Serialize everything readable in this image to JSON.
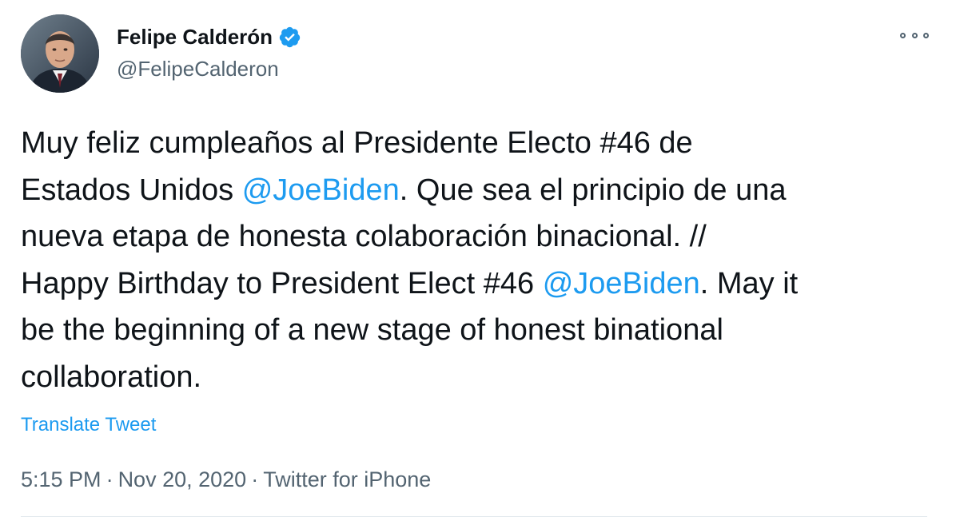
{
  "author": {
    "display_name": "Felipe Calderón",
    "handle": "@FelipeCalderon",
    "verified": true,
    "avatar_icon": "profile-photo"
  },
  "more_icon": "more-options-icon",
  "tweet": {
    "lines": [
      [
        "Muy feliz cumpleaños al Presidente Electo #46 de"
      ],
      [
        "Estados Unidos ",
        "@JoeBiden",
        ". Que sea  el principio de una"
      ],
      [
        "nueva etapa de honesta colaboración binacional. //"
      ],
      [
        "Happy Birthday to President Elect #46 ",
        "@JoeBiden",
        ". May it"
      ],
      [
        "be the beginning of a new stage of honest binational"
      ],
      [
        "collaboration."
      ]
    ]
  },
  "translate_label": "Translate Tweet",
  "meta": {
    "time": "5:15 PM",
    "separator": "·",
    "date": "Nov 20, 2020",
    "source": "Twitter for iPhone"
  },
  "colors": {
    "link": "#1d9bf0",
    "secondary_text": "#536471",
    "primary_text": "#0f1419"
  }
}
